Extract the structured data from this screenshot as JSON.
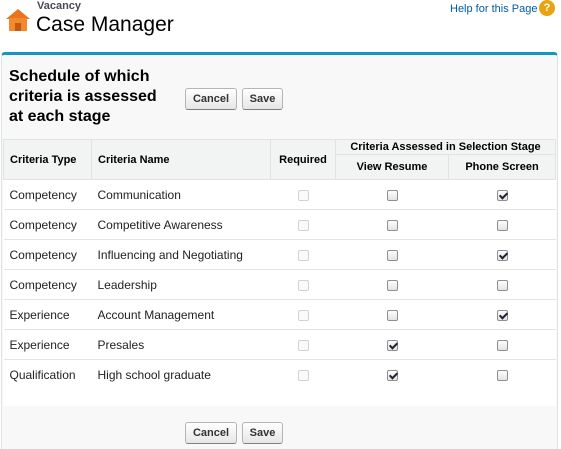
{
  "header": {
    "eyebrow": "Vacancy",
    "title": "Case Manager",
    "help_link": "Help for this Page",
    "help_icon": "?"
  },
  "panel": {
    "title": "Schedule of which criteria is assessed at each stage",
    "cancel_label": "Cancel",
    "save_label": "Save"
  },
  "table": {
    "headers": {
      "criteria_type": "Criteria Type",
      "criteria_name": "Criteria Name",
      "required": "Required",
      "group": "Criteria Assessed in Selection Stage",
      "view_resume": "View Resume",
      "phone_screen": "Phone Screen"
    },
    "rows": [
      {
        "type": "Competency",
        "name": "Communication",
        "required": false,
        "view_resume": false,
        "phone_screen": true
      },
      {
        "type": "Competency",
        "name": "Competitive Awareness",
        "required": false,
        "view_resume": false,
        "phone_screen": false
      },
      {
        "type": "Competency",
        "name": "Influencing and Negotiating",
        "required": false,
        "view_resume": false,
        "phone_screen": true
      },
      {
        "type": "Competency",
        "name": "Leadership",
        "required": false,
        "view_resume": false,
        "phone_screen": false
      },
      {
        "type": "Experience",
        "name": "Account Management",
        "required": false,
        "view_resume": false,
        "phone_screen": true
      },
      {
        "type": "Experience",
        "name": "Presales",
        "required": false,
        "view_resume": true,
        "phone_screen": false
      },
      {
        "type": "Qualification",
        "name": "High school graduate",
        "required": false,
        "view_resume": true,
        "phone_screen": false
      }
    ]
  },
  "colors": {
    "accent": "#1797c0",
    "link": "#015ba7",
    "help_icon": "#e9a310"
  }
}
